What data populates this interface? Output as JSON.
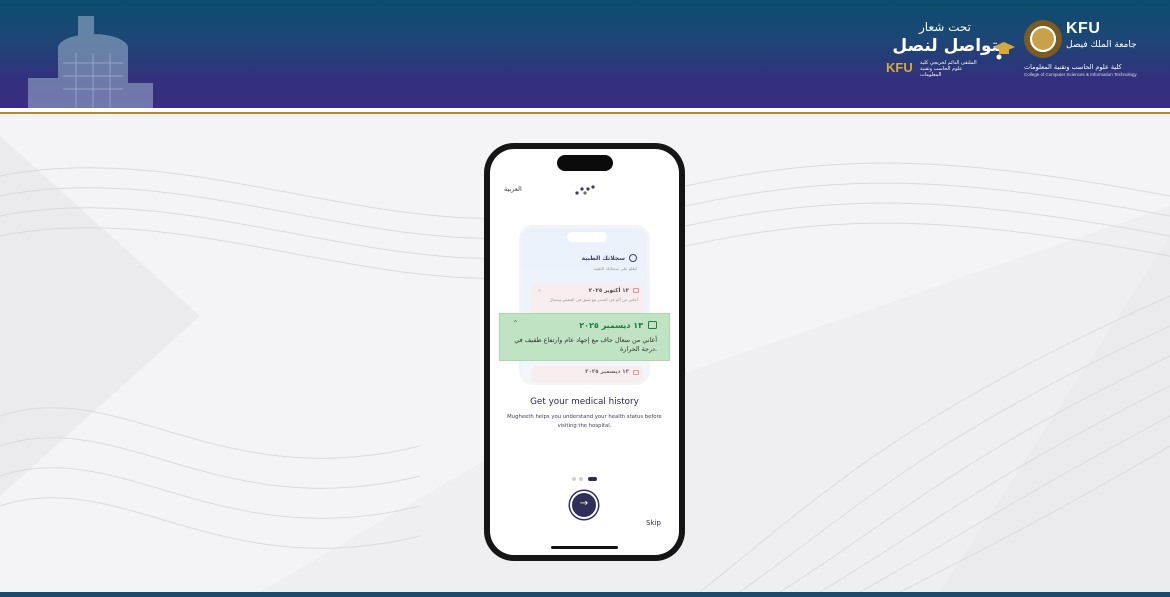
{
  "header": {
    "brand": {
      "name": "KFU",
      "arabic_name": "جامعة الملك فيصل",
      "college_arabic": "كلية علوم الحاسب وتقنية المعلومات",
      "college_english": "College of Computer Sciences & Information Technology"
    },
    "slogan": {
      "top": "تحت شعار",
      "main": "نتواصل لنصل",
      "kfu": "KFU",
      "small": "الملتقى الدائم لخريجي كلية علوم الحاسب وتقنية المعلومات"
    }
  },
  "app": {
    "language_label": "العربية",
    "mini_phone": {
      "title": "سجلاتك الطبية",
      "subtitle": "اطلع على سجلاتك الطبية",
      "card1": {
        "date": "١٢ أكتوبر ٢٠٢٥",
        "text": "أعاني من ألم في الصدر مع ضيق في التنفس وسعال"
      },
      "card2": {
        "date": "١٣ ديسمبر ٢٠٢٥"
      }
    },
    "highlight_card": {
      "date": "١٣ ديسمبر ٢٠٢٥",
      "text": "أعاني من سعال جاف مع إجهاد عام وارتفاع طفيف في درجة الحرارة."
    },
    "title": "Get your medical history",
    "description": "Mugheeth helps you understand your health status before visiting the hospital.",
    "pagination": {
      "total": 3,
      "active": 3
    },
    "next_button_icon": "→",
    "skip_label": "Skip"
  }
}
